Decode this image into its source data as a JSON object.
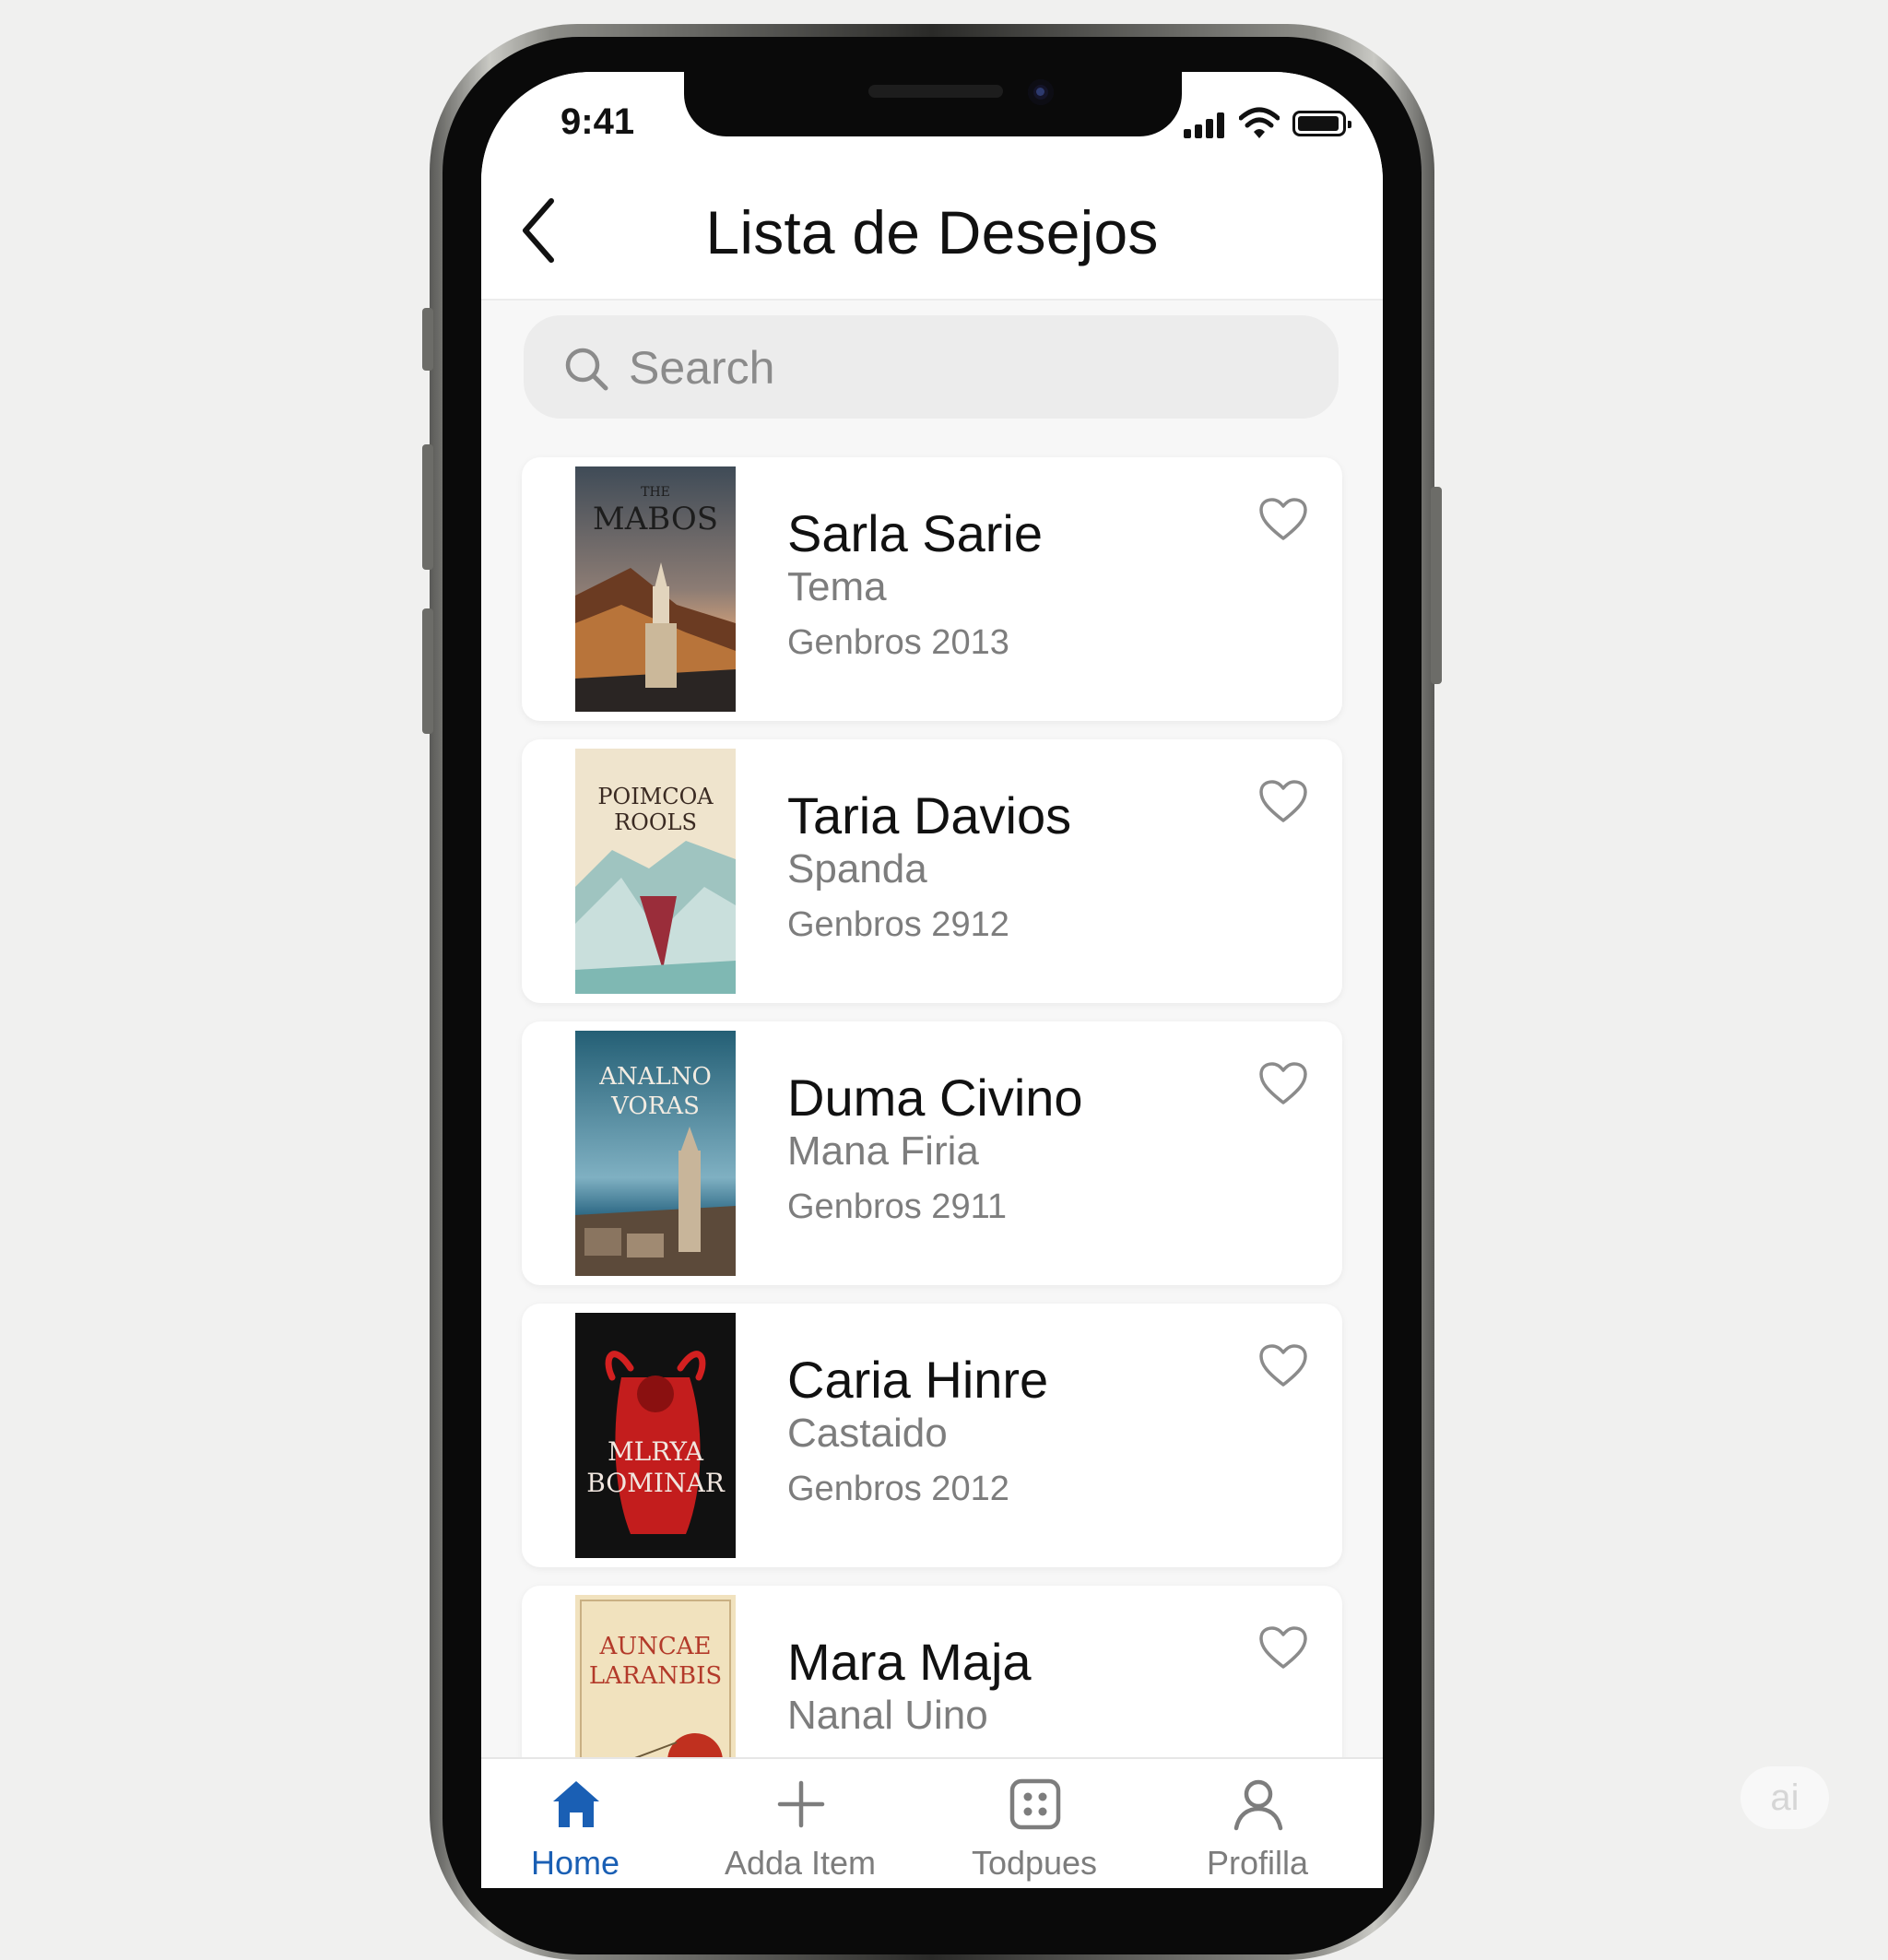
{
  "status_bar": {
    "time": "9:41"
  },
  "header": {
    "title": "Lista de Desejos"
  },
  "search": {
    "placeholder": "Search"
  },
  "books": [
    {
      "title": "Sarla Sarie",
      "author": "Tema",
      "meta": "Genbros 2013",
      "cover": {
        "line1": "THE",
        "line2": "MABOS",
        "line3": "",
        "palette": "#c9844a"
      }
    },
    {
      "title": "Taria Davios",
      "author": "Spanda",
      "meta": "Genbros 2912",
      "cover": {
        "line1": "POIMCOA",
        "line2": "ROOLS",
        "line3": "",
        "palette": "#b8d6d3"
      }
    },
    {
      "title": "Duma Civino",
      "author": "Mana Firia",
      "meta": "Genbros 2911",
      "cover": {
        "line1": "ANALNO",
        "line2": "VORAS",
        "line3": "",
        "palette": "#2e6f82"
      }
    },
    {
      "title": "Caria Hinre",
      "author": "Castaido",
      "meta": "Genbros 2012",
      "cover": {
        "line1": "MLRYA",
        "line2": "BOMINAR",
        "line3": "",
        "palette": "#c31d1d"
      }
    },
    {
      "title": "Mara Maja",
      "author": "Nanal Uino",
      "meta": "",
      "cover": {
        "line1": "AUNCAE",
        "line2": "LARANBIS",
        "line3": "",
        "palette": "#b33a2a"
      }
    }
  ],
  "tab_bar": {
    "tabs": [
      {
        "label": "Home",
        "icon": "home-icon",
        "active": true
      },
      {
        "label": "Adda Item",
        "icon": "plus-icon",
        "active": false
      },
      {
        "label": "Todpues",
        "icon": "grid-icon",
        "active": false
      },
      {
        "label": "Profilla",
        "icon": "person-icon",
        "active": false
      }
    ]
  },
  "colors": {
    "accent": "#1a5fb4",
    "background": "#f7f7f7",
    "text_secondary": "#7d7d7d"
  },
  "watermark": {
    "text": "ai"
  }
}
